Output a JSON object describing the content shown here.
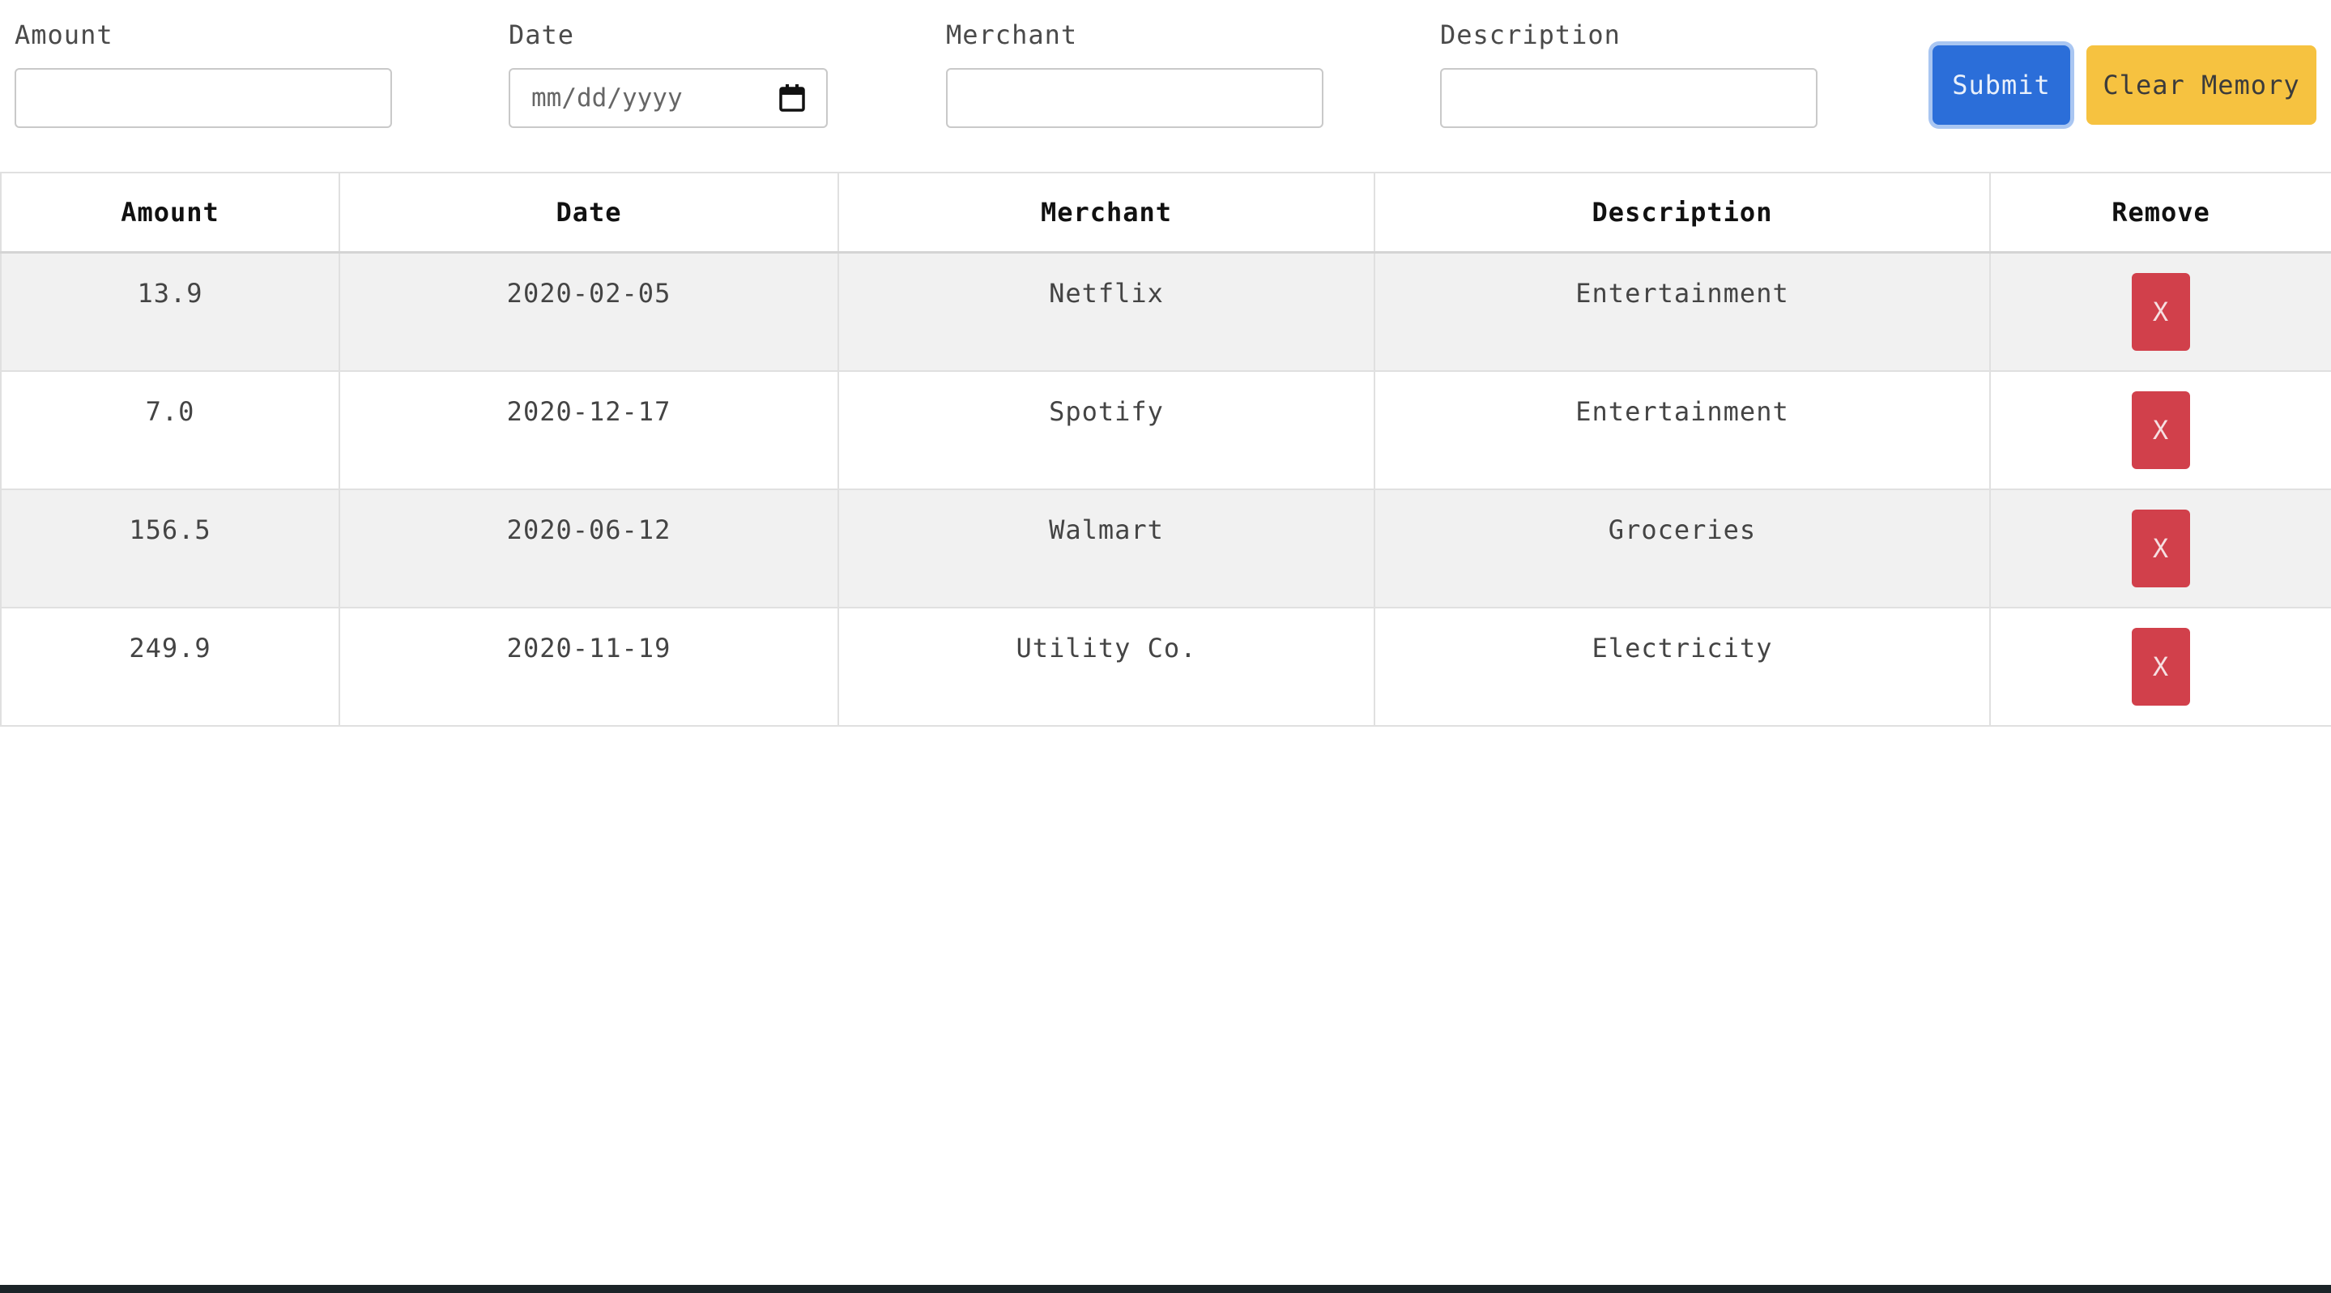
{
  "form": {
    "amount_label": "Amount",
    "amount_value": "",
    "date_label": "Date",
    "date_placeholder": "mm/dd/yyyy",
    "merchant_label": "Merchant",
    "merchant_value": "",
    "description_label": "Description",
    "description_value": "",
    "submit_label": "Submit",
    "clear_label": "Clear Memory",
    "calendar_icon": "calendar-icon"
  },
  "table": {
    "headers": {
      "amount": "Amount",
      "date": "Date",
      "merchant": "Merchant",
      "description": "Description",
      "remove": "Remove"
    },
    "rows": [
      {
        "amount": "13.9",
        "date": "2020-02-05",
        "merchant": "Netflix",
        "description": "Entertainment",
        "remove": "X"
      },
      {
        "amount": "7.0",
        "date": "2020-12-17",
        "merchant": "Spotify",
        "description": "Entertainment",
        "remove": "X"
      },
      {
        "amount": "156.5",
        "date": "2020-06-12",
        "merchant": "Walmart",
        "description": "Groceries",
        "remove": "X"
      },
      {
        "amount": "249.9",
        "date": "2020-11-19",
        "merchant": "Utility Co.",
        "description": "Electricity",
        "remove": "X"
      }
    ]
  },
  "colors": {
    "submit": "#2b6ed9",
    "clear": "#f6c240",
    "remove": "#d1404b",
    "stripe": "#f1f1f1"
  }
}
